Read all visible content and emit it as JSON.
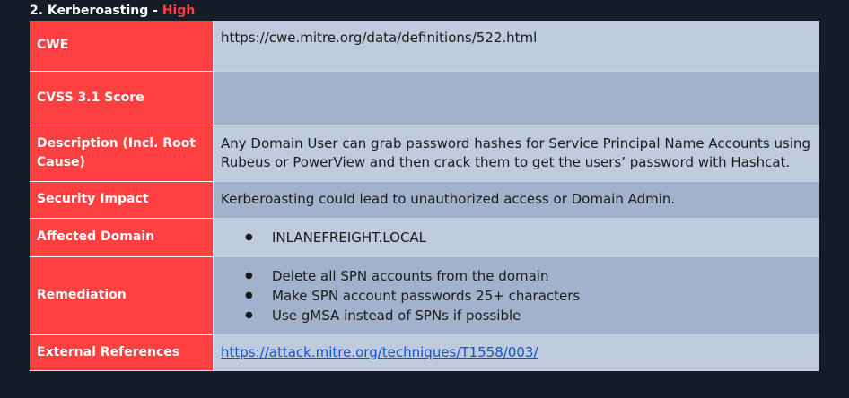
{
  "finding": {
    "number_title": "2. Kerberoasting - ",
    "severity": "High",
    "severity_color": "#ff4040"
  },
  "rows": {
    "cwe": {
      "label": "CWE",
      "value": "https://cwe.mitre.org/data/definitions/522.html"
    },
    "cvss": {
      "label": "CVSS 3.1 Score",
      "value": ""
    },
    "description": {
      "label": "Description (Incl. Root Cause)",
      "value": "Any Domain User can grab password hashes for Service Principal Name Accounts using Rubeus or PowerView and then crack them to get the users’ password with Hashcat."
    },
    "impact": {
      "label": "Security Impact",
      "value": "Kerberoasting could lead to unauthorized access or Domain Admin."
    },
    "domain": {
      "label": "Affected Domain",
      "items": [
        "INLANEFREIGHT.LOCAL"
      ]
    },
    "remediation": {
      "label": "Remediation",
      "items": [
        "Delete all SPN accounts from the domain",
        "Make SPN account passwords 25+ characters",
        "Use gMSA instead of SPNs if possible"
      ]
    },
    "references": {
      "label": "External References",
      "link": "https://attack.mitre.org/techniques/T1558/003/"
    }
  },
  "colors": {
    "label_bg": "#ff4040",
    "row_light": "#c0cadd",
    "row_dark": "#a3b2cc",
    "page_bg": "#151b27",
    "link": "#1155cc"
  }
}
